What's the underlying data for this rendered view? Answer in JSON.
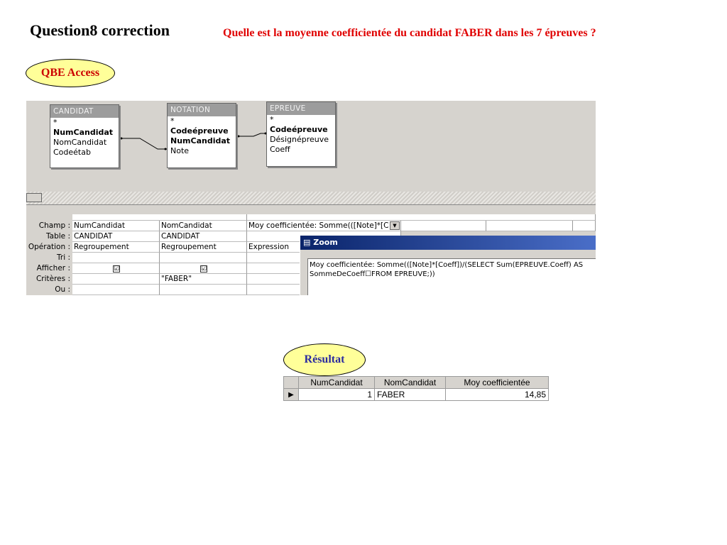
{
  "title": "Question8 correction",
  "question": "Quelle est la moyenne coefficientée du candidat FABER dans les 7 épreuves ?",
  "qbe_label": "QBE Access",
  "result_label": "Résultat",
  "tables": {
    "candidat": {
      "name": "CANDIDAT",
      "fields": [
        "*",
        "NumCandidat",
        "NomCandidat",
        "Codeétab"
      ]
    },
    "notation": {
      "name": "NOTATION",
      "fields": [
        "*",
        "Codeépreuve",
        "NumCandidat",
        "Note"
      ]
    },
    "epreuve": {
      "name": "EPREUVE",
      "fields": [
        "*",
        "Codeépreuve",
        "Désignépreuve",
        "Coeff"
      ]
    }
  },
  "grid": {
    "row_labels": [
      "Champ :",
      "Table :",
      "Opération :",
      "Tri :",
      "Afficher :",
      "Critères :",
      "Ou :"
    ],
    "col1": {
      "champ": "NumCandidat",
      "table": "CANDIDAT",
      "operation": "Regroupement",
      "afficher": "☑",
      "criteres": ""
    },
    "col2": {
      "champ": "NomCandidat",
      "table": "CANDIDAT",
      "operation": "Regroupement",
      "afficher": "☑",
      "criteres": "\"FABER\""
    },
    "col3": {
      "champ": "Moy coefficientée: Somme(([Note]*[C",
      "table": "",
      "operation": "Expression"
    }
  },
  "zoom": {
    "title": "Zoom",
    "line1": "Moy coefficientée: Somme(([Note]*[Coeff])/(SELECT Sum(EPREUVE.Coeff) AS",
    "line2": "SommeDeCoeff☐FROM EPREUVE;))"
  },
  "result": {
    "headers": [
      "NumCandidat",
      "NomCandidat",
      "Moy coefficientée"
    ],
    "row": {
      "selector": "▶",
      "num": "1",
      "nom": "FABER",
      "moy": "14,85"
    }
  }
}
